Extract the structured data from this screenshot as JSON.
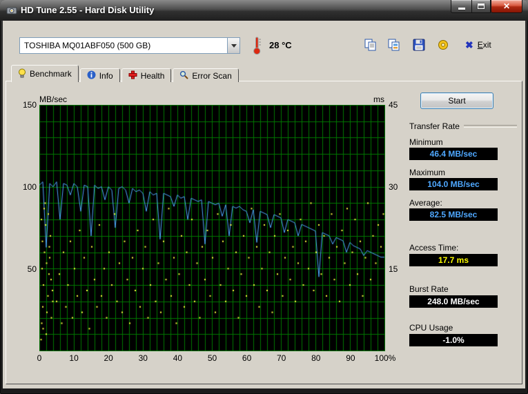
{
  "window": {
    "title": "HD Tune 2.55 - Hard Disk Utility"
  },
  "toolbar": {
    "drive_selected": "TOSHIBA MQ01ABF050 (500 GB)",
    "temperature": "28 °C",
    "exit_accel": "E",
    "exit_rest": "xit"
  },
  "tabs": {
    "benchmark": "Benchmark",
    "info": "Info",
    "health": "Health",
    "error_scan": "Error Scan"
  },
  "results": {
    "start_label": "Start",
    "transfer_rate_title": "Transfer Rate",
    "minimum_label": "Minimum",
    "minimum_value": "46.4 MB/sec",
    "maximum_label": "Maximum",
    "maximum_value": "104.0 MB/sec",
    "average_label": "Average:",
    "average_value": "82.5 MB/sec",
    "access_time_label": "Access Time:",
    "access_time_value": "17.7 ms",
    "burst_rate_label": "Burst Rate",
    "burst_rate_value": "248.0 MB/sec",
    "cpu_usage_label": "CPU Usage",
    "cpu_usage_value": "-1.0%"
  },
  "colors": {
    "grid": "#007800",
    "transfer_line": "#4fa8ff",
    "access_dots": "#ffff40",
    "chart_bg": "#000000"
  },
  "chart_data": {
    "type": "line",
    "title": "HD Tune benchmark: transfer rate (line, MB/sec) and access time (scatter, ms)",
    "background": "#000000",
    "grid": {
      "x_step": 2,
      "y_step": 10,
      "color": "#007800"
    },
    "left_axis": {
      "label": "MB/sec",
      "min": 0,
      "max": 150,
      "ticks": [
        150,
        100,
        50
      ]
    },
    "right_axis": {
      "label": "ms",
      "min": 0,
      "max": 45,
      "ticks": [
        45,
        30,
        15
      ]
    },
    "x_axis": {
      "min": 0,
      "max": 100,
      "ticks": [
        {
          "v": 0,
          "label": "0"
        },
        {
          "v": 10,
          "label": "10"
        },
        {
          "v": 20,
          "label": "20"
        },
        {
          "v": 30,
          "label": "30"
        },
        {
          "v": 40,
          "label": "40"
        },
        {
          "v": 50,
          "label": "50"
        },
        {
          "v": 60,
          "label": "60"
        },
        {
          "v": 70,
          "label": "70"
        },
        {
          "v": 80,
          "label": "80"
        },
        {
          "v": 90,
          "label": "90"
        },
        {
          "v": 100,
          "label": "100%"
        }
      ]
    },
    "series": [
      {
        "name": "transfer-rate",
        "type": "line",
        "axis": "left",
        "color": "#4fa8ff",
        "points": [
          [
            0,
            101
          ],
          [
            1,
            103
          ],
          [
            2,
            63
          ],
          [
            3,
            102
          ],
          [
            4,
            100
          ],
          [
            5,
            103
          ],
          [
            6,
            80
          ],
          [
            7,
            102
          ],
          [
            8,
            101
          ],
          [
            9,
            95
          ],
          [
            10,
            102
          ],
          [
            11,
            100
          ],
          [
            12,
            85
          ],
          [
            13,
            101
          ],
          [
            14,
            100
          ],
          [
            15,
            70
          ],
          [
            16,
            101
          ],
          [
            17,
            99
          ],
          [
            18,
            100
          ],
          [
            19,
            92
          ],
          [
            20,
            100
          ],
          [
            21,
            98
          ],
          [
            22,
            75
          ],
          [
            23,
            99
          ],
          [
            24,
            100
          ],
          [
            25,
            98
          ],
          [
            26,
            90
          ],
          [
            27,
            99
          ],
          [
            28,
            97
          ],
          [
            29,
            98
          ],
          [
            30,
            96
          ],
          [
            31,
            85
          ],
          [
            32,
            97
          ],
          [
            33,
            95
          ],
          [
            34,
            96
          ],
          [
            35,
            68
          ],
          [
            36,
            96
          ],
          [
            37,
            95
          ],
          [
            38,
            94
          ],
          [
            39,
            88
          ],
          [
            40,
            95
          ],
          [
            41,
            93
          ],
          [
            42,
            94
          ],
          [
            43,
            80
          ],
          [
            44,
            93
          ],
          [
            45,
            92
          ],
          [
            46,
            91
          ],
          [
            47,
            92
          ],
          [
            48,
            65
          ],
          [
            49,
            91
          ],
          [
            50,
            90
          ],
          [
            51,
            89
          ],
          [
            52,
            90
          ],
          [
            53,
            82
          ],
          [
            54,
            89
          ],
          [
            55,
            70
          ],
          [
            56,
            88
          ],
          [
            57,
            87
          ],
          [
            58,
            88
          ],
          [
            59,
            86
          ],
          [
            60,
            85
          ],
          [
            61,
            78
          ],
          [
            62,
            86
          ],
          [
            63,
            66
          ],
          [
            64,
            85
          ],
          [
            65,
            84
          ],
          [
            66,
            83
          ],
          [
            67,
            75
          ],
          [
            68,
            83
          ],
          [
            69,
            82
          ],
          [
            70,
            81
          ],
          [
            71,
            72
          ],
          [
            72,
            80
          ],
          [
            73,
            79
          ],
          [
            74,
            78
          ],
          [
            75,
            70
          ],
          [
            76,
            77
          ],
          [
            77,
            76
          ],
          [
            78,
            75
          ],
          [
            79,
            74
          ],
          [
            80,
            73
          ],
          [
            81,
            45
          ],
          [
            82,
            72
          ],
          [
            83,
            71
          ],
          [
            84,
            70
          ],
          [
            85,
            65
          ],
          [
            86,
            69
          ],
          [
            87,
            68
          ],
          [
            88,
            67
          ],
          [
            89,
            60
          ],
          [
            90,
            66
          ],
          [
            91,
            64
          ],
          [
            92,
            63
          ],
          [
            93,
            62
          ],
          [
            94,
            58
          ],
          [
            95,
            61
          ],
          [
            96,
            60
          ],
          [
            97,
            59
          ],
          [
            98,
            58
          ],
          [
            99,
            57
          ],
          [
            100,
            57
          ]
        ]
      },
      {
        "name": "access-time",
        "type": "scatter",
        "axis": "right",
        "color": "#ffff40",
        "points": [
          [
            0.5,
            2
          ],
          [
            0.7,
            5
          ],
          [
            1,
            8
          ],
          [
            1.2,
            12
          ],
          [
            0.8,
            15
          ],
          [
            1.5,
            18
          ],
          [
            2,
            3
          ],
          [
            2.2,
            7
          ],
          [
            2.5,
            10
          ],
          [
            2.8,
            14
          ],
          [
            3,
            17
          ],
          [
            3.2,
            21
          ],
          [
            1.8,
            23
          ],
          [
            2.6,
            25
          ],
          [
            3.5,
            6
          ],
          [
            3.8,
            11
          ],
          [
            0.9,
            20
          ],
          [
            1.4,
            26
          ],
          [
            2.1,
            16
          ],
          [
            3.9,
            9
          ],
          [
            1.1,
            4
          ],
          [
            2.9,
            19
          ],
          [
            3.4,
            13
          ],
          [
            0.6,
            24
          ],
          [
            1.7,
            27
          ],
          [
            5,
            9
          ],
          [
            5.8,
            14
          ],
          [
            6.5,
            5
          ],
          [
            7,
            18
          ],
          [
            7.7,
            8
          ],
          [
            8.3,
            12
          ],
          [
            9,
            20
          ],
          [
            9.6,
            6
          ],
          [
            10.2,
            15
          ],
          [
            11,
            10
          ],
          [
            11.7,
            22
          ],
          [
            12.4,
            7
          ],
          [
            13,
            17
          ],
          [
            13.8,
            11
          ],
          [
            14.5,
            4
          ],
          [
            15.2,
            19
          ],
          [
            16,
            13
          ],
          [
            16.7,
            8
          ],
          [
            17.4,
            23
          ],
          [
            18,
            10
          ],
          [
            18.8,
            15
          ],
          [
            19.5,
            6
          ],
          [
            20.2,
            18
          ],
          [
            21,
            12
          ],
          [
            21.8,
            25
          ],
          [
            22.5,
            9
          ],
          [
            23.2,
            16
          ],
          [
            24,
            7
          ],
          [
            24.7,
            20
          ],
          [
            25.5,
            13
          ],
          [
            26.2,
            5
          ],
          [
            27,
            17
          ],
          [
            27.8,
            11
          ],
          [
            28.5,
            22
          ],
          [
            29.2,
            8
          ],
          [
            30,
            15
          ],
          [
            30.7,
            19
          ],
          [
            31.5,
            6
          ],
          [
            32.2,
            12
          ],
          [
            33,
            24
          ],
          [
            33.7,
            9
          ],
          [
            34.5,
            16
          ],
          [
            35.2,
            7
          ],
          [
            36,
            20
          ],
          [
            36.7,
            13
          ],
          [
            37.5,
            26
          ],
          [
            38.2,
            10
          ],
          [
            39,
            17
          ],
          [
            39.7,
            5
          ],
          [
            40.5,
            14
          ],
          [
            41.2,
            21
          ],
          [
            42,
            8
          ],
          [
            42.7,
            18
          ],
          [
            43.5,
            12
          ],
          [
            44.2,
            24
          ],
          [
            45,
            9
          ],
          [
            45.7,
            16
          ],
          [
            46.5,
            6
          ],
          [
            47.2,
            19
          ],
          [
            48,
            13
          ],
          [
            48.7,
            22
          ],
          [
            49.5,
            10
          ],
          [
            50.2,
            17
          ],
          [
            51,
            7
          ],
          [
            51.7,
            25
          ],
          [
            52.5,
            12
          ],
          [
            53.2,
            20
          ],
          [
            54,
            9
          ],
          [
            54.7,
            15
          ],
          [
            55.5,
            23
          ],
          [
            56.2,
            11
          ],
          [
            57,
            18
          ],
          [
            57.7,
            6
          ],
          [
            58.5,
            14
          ],
          [
            59.2,
            21
          ],
          [
            60,
            10
          ],
          [
            60.7,
            17
          ],
          [
            61.5,
            26
          ],
          [
            62.2,
            12
          ],
          [
            63,
            19
          ],
          [
            63.7,
            8
          ],
          [
            64.5,
            15
          ],
          [
            65.2,
            23
          ],
          [
            66,
            11
          ],
          [
            66.7,
            18
          ],
          [
            67.5,
            7
          ],
          [
            68.2,
            21
          ],
          [
            69,
            14
          ],
          [
            69.7,
            25
          ],
          [
            70.5,
            10
          ],
          [
            71.2,
            17
          ],
          [
            72,
            22
          ],
          [
            72.7,
            13
          ],
          [
            73.5,
            19
          ],
          [
            74.2,
            9
          ],
          [
            75,
            16
          ],
          [
            75.7,
            24
          ],
          [
            76.5,
            12
          ],
          [
            77.2,
            20
          ],
          [
            78,
            15
          ],
          [
            78.7,
            27
          ],
          [
            79.5,
            11
          ],
          [
            80.2,
            18
          ],
          [
            81,
            23
          ],
          [
            81.7,
            14
          ],
          [
            82.5,
            21
          ],
          [
            83.2,
            10
          ],
          [
            84,
            17
          ],
          [
            84.7,
            25
          ],
          [
            85.5,
            13
          ],
          [
            86.2,
            19
          ],
          [
            87,
            9
          ],
          [
            87.7,
            22
          ],
          [
            88.5,
            16
          ],
          [
            89.2,
            26
          ],
          [
            90,
            12
          ],
          [
            90.7,
            18
          ],
          [
            91.5,
            24
          ],
          [
            92.2,
            14
          ],
          [
            93,
            20
          ],
          [
            93.7,
            10
          ],
          [
            94.5,
            17
          ],
          [
            95.2,
            27
          ],
          [
            96,
            13
          ],
          [
            96.7,
            21
          ],
          [
            97.5,
            16
          ],
          [
            98.2,
            23
          ],
          [
            99,
            19
          ],
          [
            99.7,
            25
          ]
        ]
      }
    ]
  }
}
